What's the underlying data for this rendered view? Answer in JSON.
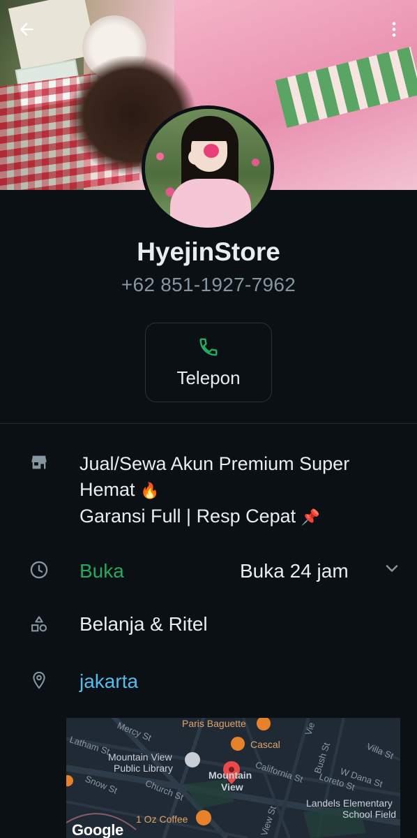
{
  "header": {
    "name": "HyejinStore",
    "phone": "+62 851-1927-7962",
    "back_icon": "arrow-back-icon",
    "more_icon": "more-vertical-icon"
  },
  "actions": {
    "call_label": "Telepon",
    "call_icon": "phone-icon"
  },
  "business": {
    "about_line1": "Jual/Sewa Akun Premium Super",
    "about_line2": "Hemat",
    "about_emoji1": "🔥",
    "about_line3": "Garansi Full |  Resp Cepat",
    "about_emoji2": "📌",
    "status": "Buka",
    "hours": "Buka 24 jam",
    "category": "Belanja & Ritel",
    "location": "jakarta"
  },
  "map": {
    "labels": {
      "paris_baguette": "Paris Baguette",
      "cascal": "Cascal",
      "mercy_st": "Mercy St",
      "latham_st": "Latham St",
      "mv_library_1": "Mountain View",
      "mv_library_2": "Public Library",
      "mountain_view_1": "Mountain",
      "mountain_view_2": "View",
      "california_st": "California St",
      "bush_st": "Bush St",
      "villa_st": "Villa St",
      "w_dana_st": "W Dana St",
      "loreto_st": "Loreto St",
      "snow_st": "Snow St",
      "church_st": "Church St",
      "landels_1": "Landels Elementary",
      "landels_2": "School Field",
      "one_oz_coffee": "1 Oz Coffee",
      "view_st": "View St",
      "vie": "Vie",
      "google": "Google"
    }
  },
  "colors": {
    "background": "#0b1014",
    "accent_green": "#25a95f",
    "link_blue": "#53bdeb",
    "secondary_text": "#8696a0"
  }
}
